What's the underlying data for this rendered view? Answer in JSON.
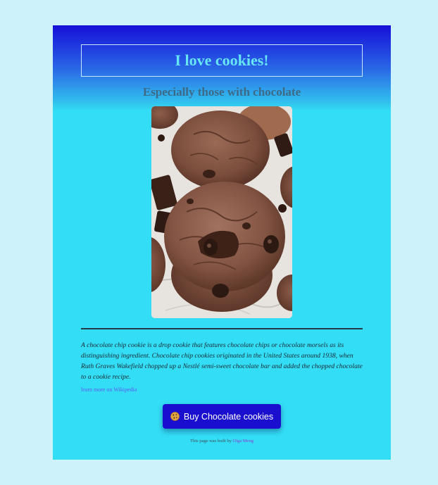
{
  "header": {
    "title": "I love cookies!",
    "subtitle": "Especially those with chocolate"
  },
  "main": {
    "image_alt": "Chocolate chip cookies",
    "description": "A chocolate chip cookie is a drop cookie that features chocolate chips or chocolate morsels as its distinguishing ingredient. Chocolate chip cookies originated in the United States around 1938, when Ruth Graves Wakefield chopped up a Nestlé semi-sweet chocolate bar and added the chopped chocolate to a cookie recipe.",
    "wiki_link_label": "learn more on Wikipedia"
  },
  "cta": {
    "buy_label": "Buy Chocolate cookies",
    "icon": "cookie-icon"
  },
  "footer": {
    "prefix": "This page was built by",
    "author": "Olga Meng"
  },
  "colors": {
    "page_background": "#cdf2fa",
    "card_top": "#1510d8",
    "card_main": "#33ddf5",
    "title_text": "#66e6f6",
    "subtitle_text": "#3d6a86",
    "button_background": "#1b0fcf",
    "link": "#5a5af0",
    "author_link": "#8a3bd6"
  }
}
